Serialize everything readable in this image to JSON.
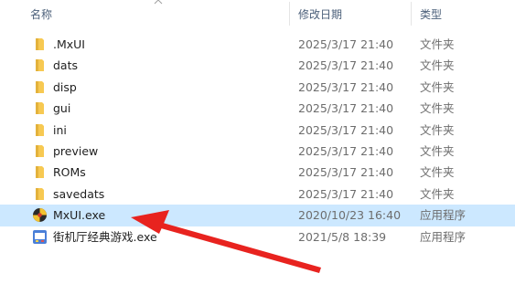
{
  "header": {
    "name_label": "名称",
    "date_label": "修改日期",
    "type_label": "类型"
  },
  "files": [
    {
      "name": ".MxUI",
      "date": "2025/3/17 21:40",
      "type": "文件夹",
      "icon": "folder-icon"
    },
    {
      "name": "dats",
      "date": "2025/3/17 21:40",
      "type": "文件夹",
      "icon": "folder-icon"
    },
    {
      "name": "disp",
      "date": "2025/3/17 21:40",
      "type": "文件夹",
      "icon": "folder-icon"
    },
    {
      "name": "gui",
      "date": "2025/3/17 21:40",
      "type": "文件夹",
      "icon": "folder-icon"
    },
    {
      "name": "ini",
      "date": "2025/3/17 21:40",
      "type": "文件夹",
      "icon": "folder-icon"
    },
    {
      "name": "preview",
      "date": "2025/3/17 21:40",
      "type": "文件夹",
      "icon": "folder-icon"
    },
    {
      "name": "ROMs",
      "date": "2025/3/17 21:40",
      "type": "文件夹",
      "icon": "folder-icon"
    },
    {
      "name": "savedats",
      "date": "2025/3/17 21:40",
      "type": "文件夹",
      "icon": "folder-icon"
    },
    {
      "name": "MxUI.exe",
      "date": "2020/10/23 16:40",
      "type": "应用程序",
      "icon": "mxui-app-icon",
      "selected": true
    },
    {
      "name": "街机厅经典游戏.exe",
      "date": "2021/5/8 18:39",
      "type": "应用程序",
      "icon": "arcade-app-icon"
    }
  ],
  "colors": {
    "selection": "#cce8ff",
    "folder": "#f7c952",
    "arrow": "#e8231f",
    "header_text": "#4c607a"
  }
}
